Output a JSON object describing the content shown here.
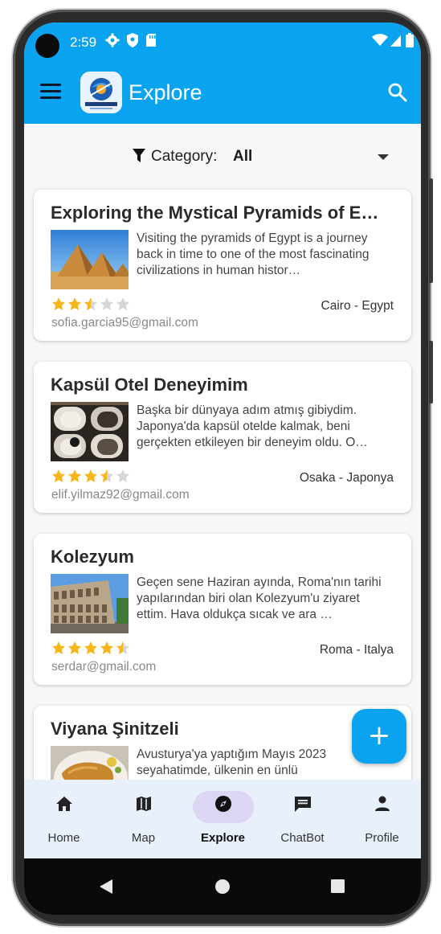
{
  "status_bar": {
    "time": "2:59"
  },
  "app_bar": {
    "title": "Explore",
    "logo_text": "TRAVEL GUIDE"
  },
  "filter": {
    "label": "Category:",
    "value": "All"
  },
  "posts": [
    {
      "title": "Exploring the Mystical Pyramids of E…",
      "description": "Visiting the pyramids of Egypt is a journey back in time to one of the most fascinating civilizations in human histor…",
      "location": "Cairo - Egypt",
      "email": "sofia.garcia95@gmail.com",
      "rating": 2.5
    },
    {
      "title": "Kapsül Otel Deneyimim",
      "description": "Başka bir dünyaya adım atmış gibiydim. Japonya'da kapsül otelde kalmak, beni gerçekten etkileyen bir deneyim oldu. O…",
      "location": "Osaka - Japonya",
      "email": "elif.yilmaz92@gmail.com",
      "rating": 3.5
    },
    {
      "title": "Kolezyum",
      "description": "Geçen sene Haziran ayında, Roma'nın tarihi yapılarından biri olan Kolezyum'u ziyaret ettim. Hava oldukça sıcak ve ara …",
      "location": "Roma - Italya",
      "email": "serdar@gmail.com",
      "rating": 4.5
    },
    {
      "title": "Viyana Şinitzeli",
      "description": "Avusturya'ya yaptığım Mayıs 2023 seyahatimde, ülkenin en ünlü",
      "location": "",
      "email": "",
      "rating": 0
    }
  ],
  "fab": {
    "label": "+"
  },
  "nav": [
    {
      "label": "Home",
      "icon": "home-icon"
    },
    {
      "label": "Map",
      "icon": "map-icon"
    },
    {
      "label": "Explore",
      "icon": "compass-icon",
      "active": true
    },
    {
      "label": "ChatBot",
      "icon": "chat-icon"
    },
    {
      "label": "Profile",
      "icon": "person-icon"
    }
  ],
  "colors": {
    "primary": "#0aa3f0",
    "star": "#f7b619",
    "nav_bg": "#e7f0fb",
    "nav_active": "#dcd5f4"
  }
}
